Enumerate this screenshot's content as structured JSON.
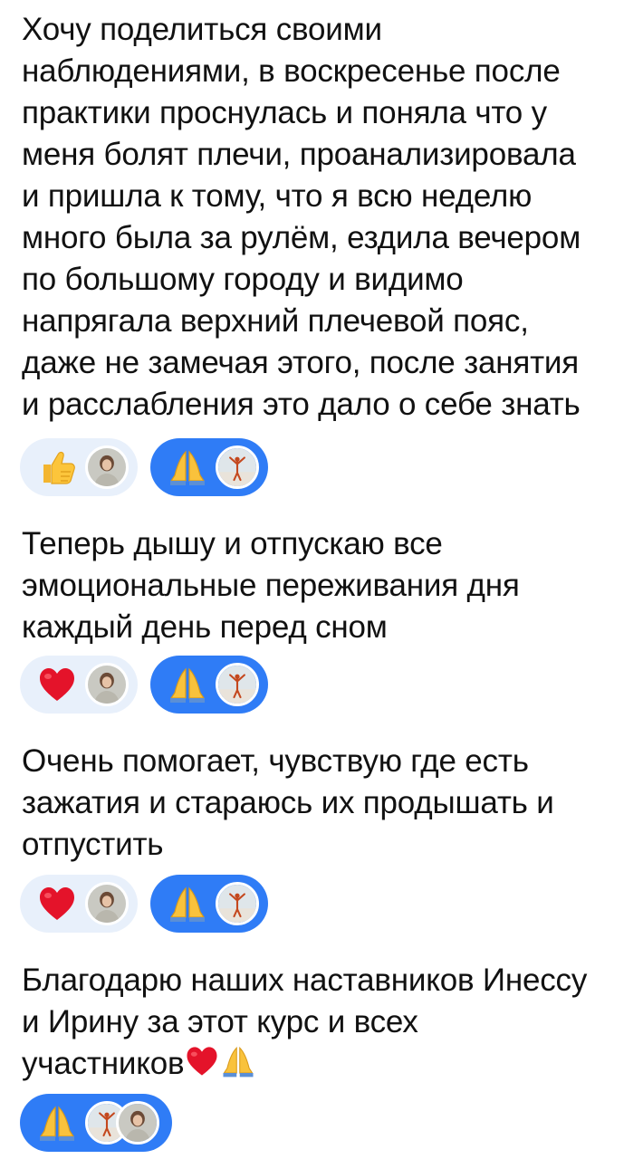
{
  "messages": [
    {
      "lines": [
        "Хочу поделиться своими",
        "наблюдениями, в воскресенье после",
        "практики проснулась и поняла что у",
        "меня болят плечи, проанализировала",
        "и пришла к тому, что я всю неделю",
        "много была за рулём, ездила вечером",
        "по большому городу и видимо",
        "напрягала верхний плечевой пояс,",
        "даже не замечая этого, после занятия",
        "и расслабления это дало о себе знать"
      ],
      "reactions": [
        {
          "icon": "thumbs-up-icon",
          "style": "light",
          "avatars": [
            "avatar-woman"
          ]
        },
        {
          "icon": "folded-hands-icon",
          "style": "blue",
          "avatars": [
            "avatar-yoga"
          ]
        }
      ]
    },
    {
      "lines": [
        "Теперь дышу и отпускаю все",
        "эмоциональные переживания дня",
        "каждый день перед сном"
      ],
      "reactions": [
        {
          "icon": "red-heart-icon",
          "style": "light",
          "avatars": [
            "avatar-woman"
          ]
        },
        {
          "icon": "folded-hands-icon",
          "style": "blue",
          "avatars": [
            "avatar-yoga"
          ]
        }
      ]
    },
    {
      "lines": [
        "Очень помогает, чувствую где есть",
        "зажатия и стараюсь их продышать и",
        "отпустить"
      ],
      "reactions": [
        {
          "icon": "red-heart-icon",
          "style": "light",
          "avatars": [
            "avatar-woman"
          ]
        },
        {
          "icon": "folded-hands-icon",
          "style": "blue",
          "avatars": [
            "avatar-yoga"
          ]
        }
      ]
    },
    {
      "lines": [
        "Благодарю наших наставников Инессу",
        "и Ирину за этот курс и всех",
        "участников"
      ],
      "trailing_emojis": [
        "red-heart-icon",
        "folded-hands-icon"
      ],
      "reactions": [
        {
          "icon": "folded-hands-icon",
          "style": "blue",
          "avatars": [
            "avatar-yoga",
            "avatar-woman"
          ]
        }
      ]
    }
  ],
  "colors": {
    "reaction_light": "#e8f0fb",
    "reaction_selected": "#2f7cf6",
    "text": "#111111"
  }
}
